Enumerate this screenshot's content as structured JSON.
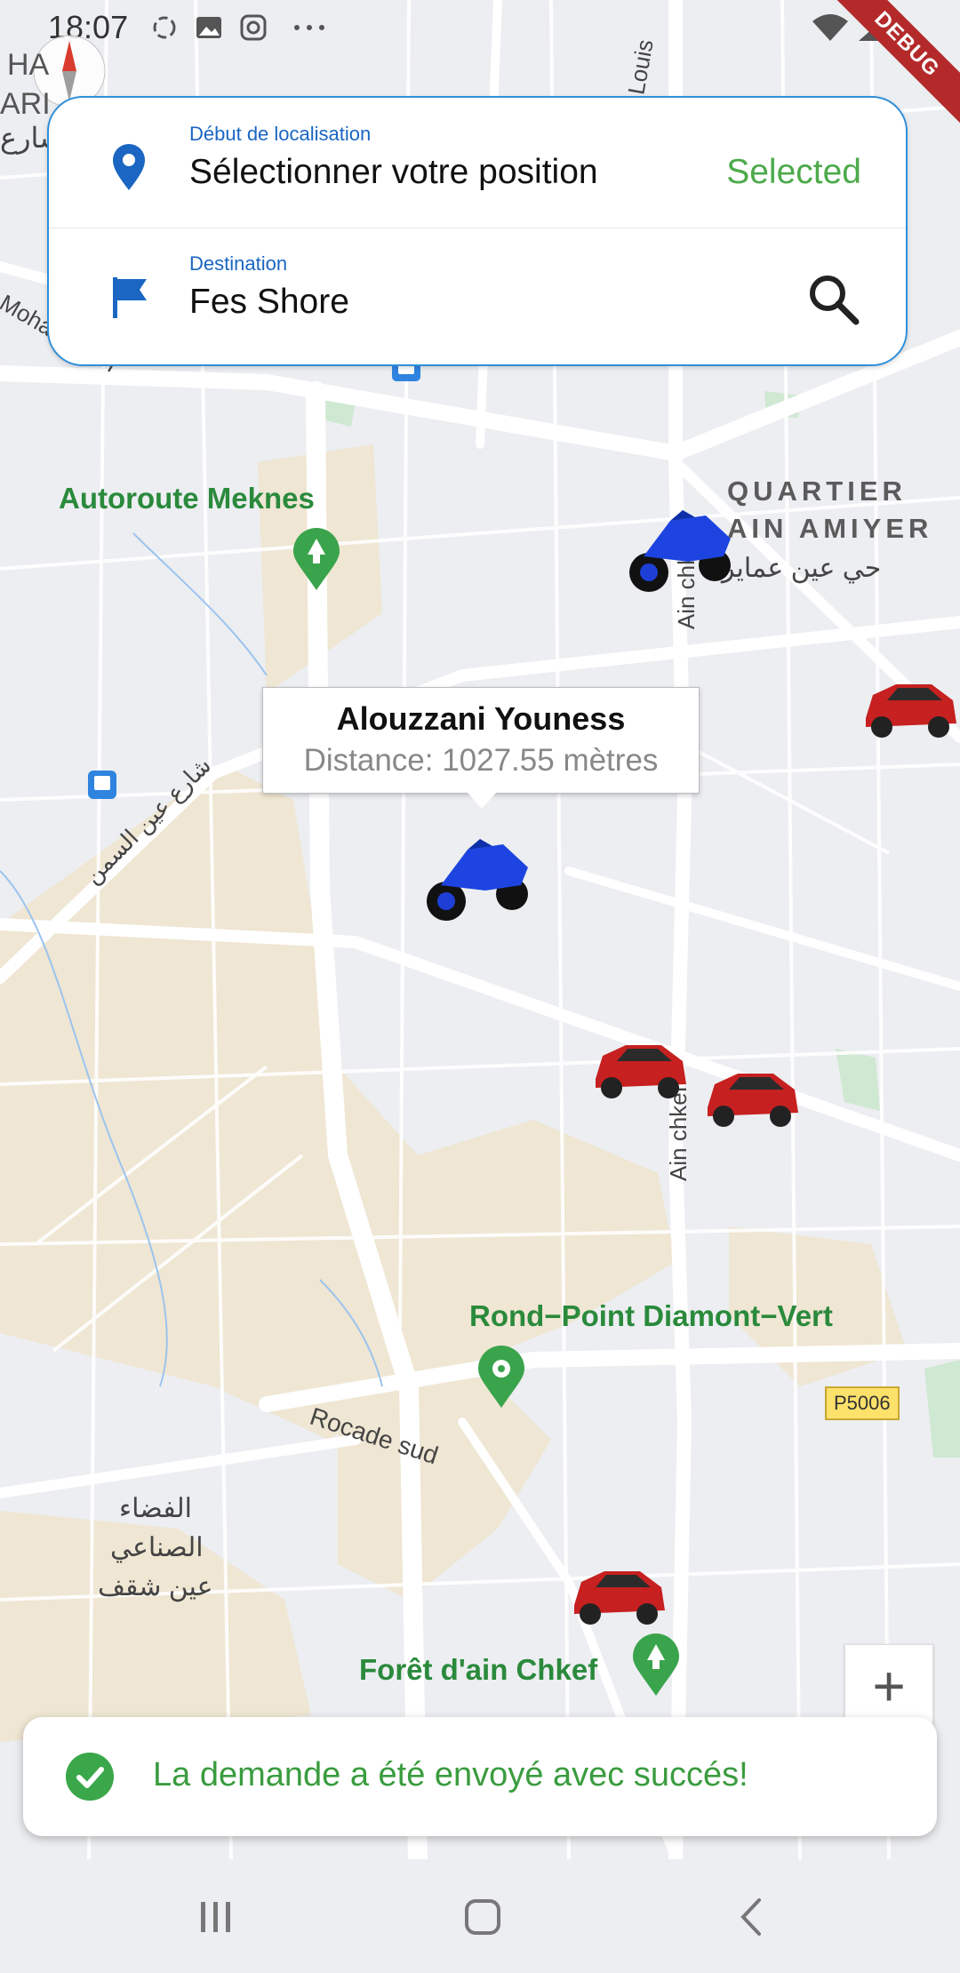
{
  "status_bar": {
    "time": "18:07",
    "debug_label": "DEBUG"
  },
  "search_card": {
    "start_caption": "Début de localisation",
    "start_value": "Sélectionner votre position",
    "start_status": "Selected",
    "destination_caption": "Destination",
    "destination_value": "Fes Shore"
  },
  "map": {
    "poi_autoroute": "Autoroute Meknes",
    "poi_rond_point": "Rond−Point Diamont−Vert",
    "poi_foret": "Forêt d'ain Chkef",
    "quartier_line1": "QUARTIER",
    "quartier_line2": "AIN AMIYER",
    "quartier_arabic": "حي عين عماير",
    "street_ain_semen": "شارع عين السمن",
    "street_rocade": "Rocade sud",
    "street_ain_chkef_1": "Ain chk",
    "street_ain_chkef_2": "Ain chkef",
    "zone_arabic_1": "الفضاء",
    "zone_arabic_2": "الصناعي",
    "zone_arabic_3": "عين شقف",
    "road_badge": "P5006",
    "partial_top_left_1": "HA",
    "partial_top_left_2": "ARI",
    "partial_mohamed": "Mohamed VI",
    "partial_louis": "Louis",
    "partial_arabic_top": "شارع"
  },
  "info_window": {
    "driver_name": "Alouzzani Youness",
    "distance": "Distance: 1027.55 mètres"
  },
  "zoom": {
    "plus_label": "+"
  },
  "snackbar": {
    "message": "La demande a été envoyé avec succés!"
  },
  "colors": {
    "accent_blue": "#1a66c2",
    "success_green": "#3aa84a",
    "card_border": "#2f8fd9",
    "poi_green": "#2a8a3c"
  }
}
